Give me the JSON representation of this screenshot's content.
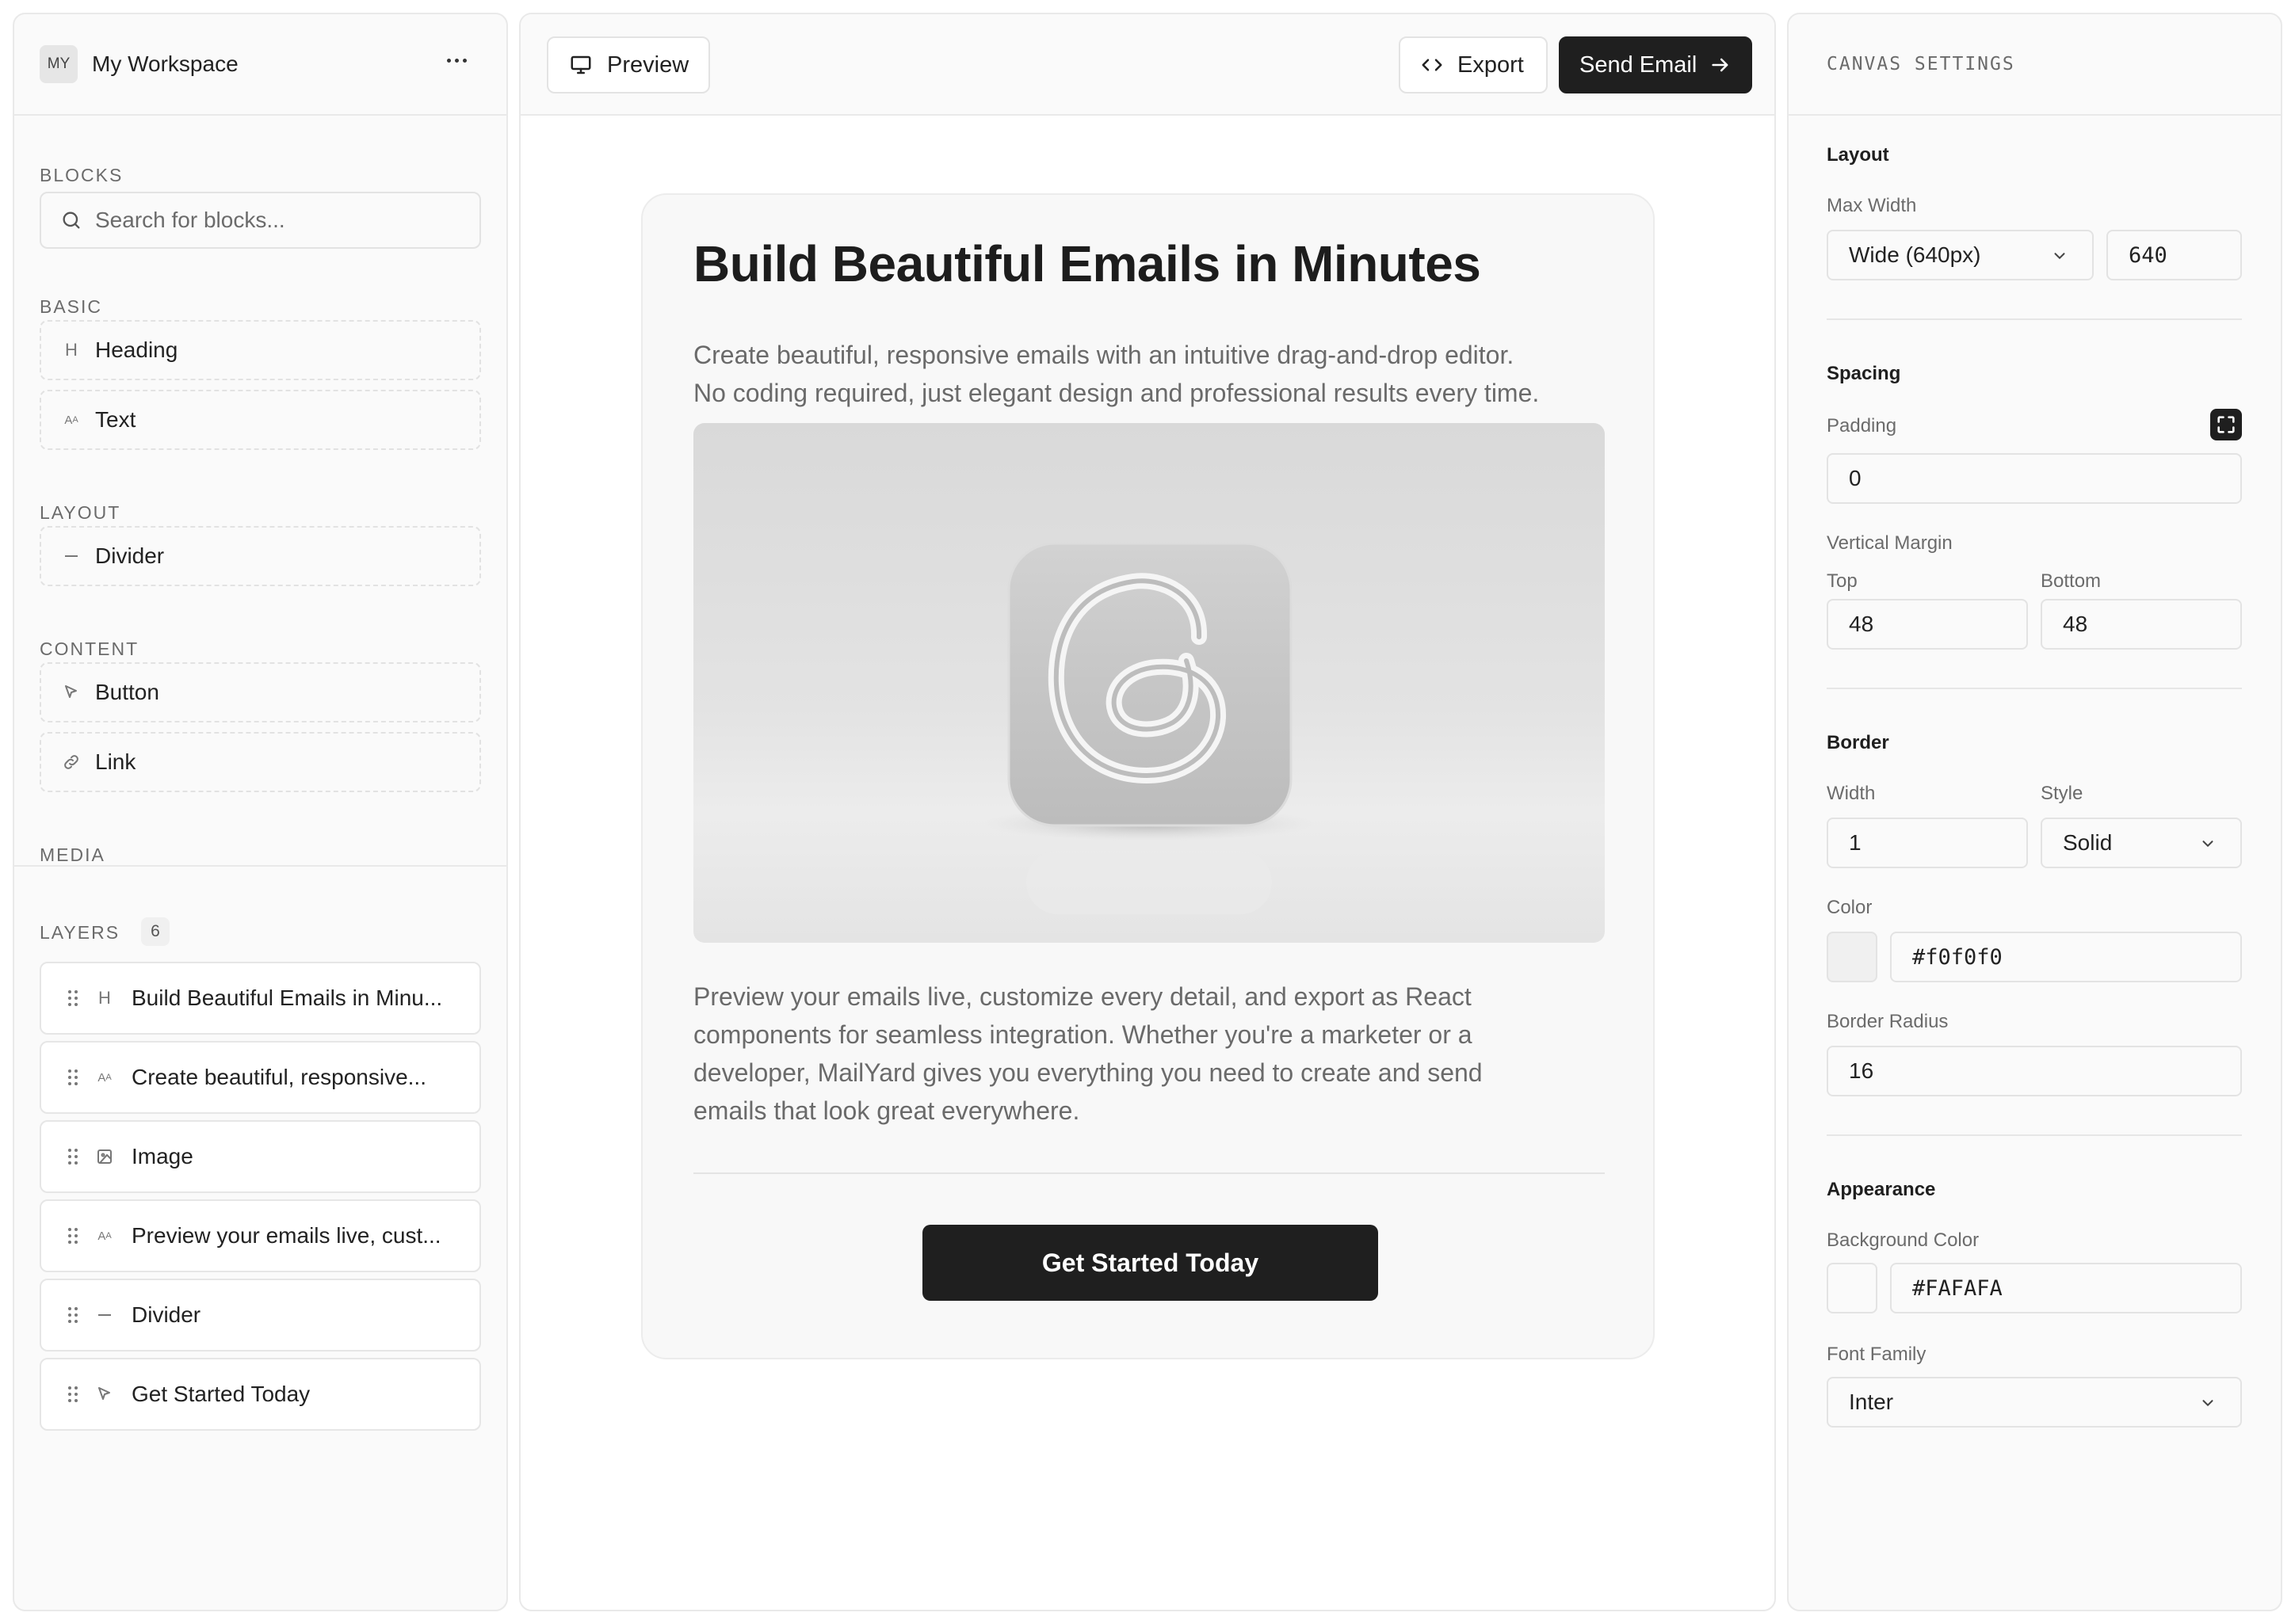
{
  "workspace": {
    "avatar_initials": "MY",
    "name": "My Workspace"
  },
  "blocks": {
    "section_label": "BLOCKS",
    "search_placeholder": "Search for blocks...",
    "groups": [
      {
        "label": "BASIC",
        "items": [
          {
            "icon": "heading-icon",
            "label": "Heading"
          },
          {
            "icon": "text-icon",
            "label": "Text"
          }
        ]
      },
      {
        "label": "LAYOUT",
        "items": [
          {
            "icon": "divider-icon",
            "label": "Divider"
          }
        ]
      },
      {
        "label": "CONTENT",
        "items": [
          {
            "icon": "cursor-icon",
            "label": "Button"
          },
          {
            "icon": "link-icon",
            "label": "Link"
          }
        ]
      },
      {
        "label": "MEDIA",
        "items": []
      }
    ]
  },
  "layers": {
    "label": "LAYERS",
    "count": "6",
    "items": [
      {
        "icon": "heading-icon",
        "label": "Build Beautiful Emails in Minu..."
      },
      {
        "icon": "text-icon",
        "label": "Create beautiful, responsive..."
      },
      {
        "icon": "image-icon",
        "label": "Image"
      },
      {
        "icon": "text-icon",
        "label": "Preview your emails live, cust..."
      },
      {
        "icon": "divider-icon",
        "label": "Divider"
      },
      {
        "icon": "cursor-icon",
        "label": "Get Started Today"
      }
    ]
  },
  "toolbar": {
    "preview_label": "Preview",
    "export_label": "Export",
    "send_label": "Send Email"
  },
  "email": {
    "heading": "Build Beautiful Emails in Minutes",
    "intro_line1": "Create beautiful, responsive emails with an intuitive drag-and-drop editor.",
    "intro_line2": "No coding required, just elegant design and professional results every time.",
    "body_line1": "Preview your emails live, customize every detail, and export as React",
    "body_line2": "components for seamless integration. Whether you're a marketer or a",
    "body_line3": "developer, MailYard gives you everything you need to create and send",
    "body_line4": "emails that look great everywhere.",
    "cta_label": "Get Started Today"
  },
  "settings": {
    "header": "CANVAS SETTINGS",
    "layout": {
      "title": "Layout",
      "max_width_label": "Max Width",
      "max_width_option": "Wide (640px)",
      "max_width_value": "640"
    },
    "spacing": {
      "title": "Spacing",
      "padding_label": "Padding",
      "padding_value": "0",
      "vertical_margin_label": "Vertical Margin",
      "top_label": "Top",
      "top_value": "48",
      "bottom_label": "Bottom",
      "bottom_value": "48"
    },
    "border": {
      "title": "Border",
      "width_label": "Width",
      "width_value": "1",
      "style_label": "Style",
      "style_value": "Solid",
      "color_label": "Color",
      "color_value": "#f0f0f0",
      "radius_label": "Border Radius",
      "radius_value": "16"
    },
    "appearance": {
      "title": "Appearance",
      "bg_label": "Background Color",
      "bg_value": "#FAFAFA",
      "font_label": "Font Family",
      "font_value": "Inter"
    }
  },
  "colors": {
    "border_swatch": "#f0f0f0",
    "background_swatch": "#FAFAFA",
    "primary_button": "#1f1f1f"
  }
}
